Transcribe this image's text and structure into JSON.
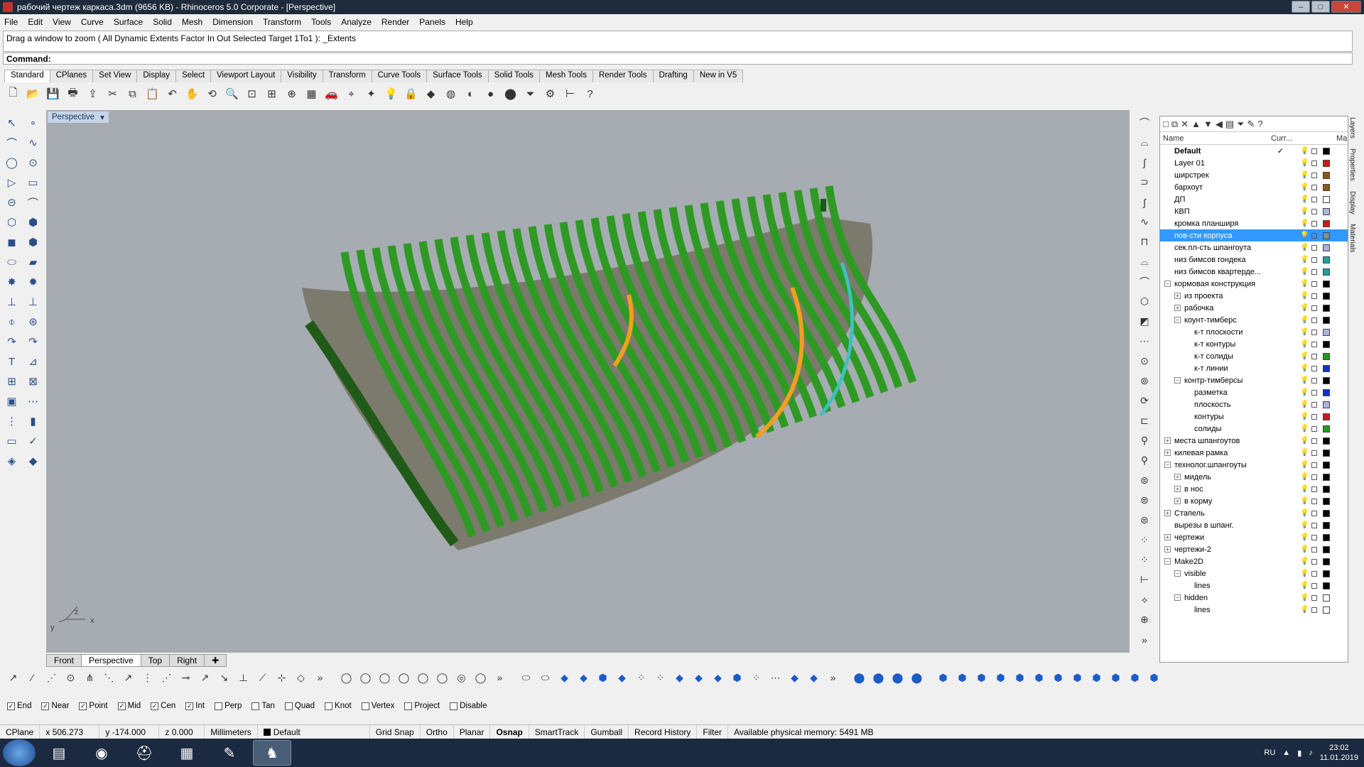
{
  "window": {
    "title": "рабочий чертеж каркаса.3dm (9656 KB) - Rhinoceros  5.0 Corporate - [Perspective]"
  },
  "menu": [
    "File",
    "Edit",
    "View",
    "Curve",
    "Surface",
    "Solid",
    "Mesh",
    "Dimension",
    "Transform",
    "Tools",
    "Analyze",
    "Render",
    "Panels",
    "Help"
  ],
  "command": {
    "history": "Drag a window to zoom ( All  Dynamic  Extents  Factor  In  Out  Selected  Target  1To1 ): _Extents",
    "prompt": "Command:"
  },
  "toolbar_tabs": [
    "Standard",
    "CPlanes",
    "Set View",
    "Display",
    "Select",
    "Viewport Layout",
    "Visibility",
    "Transform",
    "Curve Tools",
    "Surface Tools",
    "Solid Tools",
    "Mesh Tools",
    "Render Tools",
    "Drafting",
    "New in V5"
  ],
  "standard_icons": [
    "new-icon",
    "open-icon",
    "save-icon",
    "print-icon",
    "import-icon",
    "cut-icon",
    "copy-icon",
    "paste-icon",
    "undo-icon",
    "pan-icon",
    "rotate-view-icon",
    "zoom-icon",
    "zoom-window-icon",
    "zoom-extents-icon",
    "zoom-selected-icon",
    "viewport-layout-icon",
    "car-icon",
    "cplane-icon",
    "snap-icon",
    "light-icon",
    "lock-icon",
    "layer-icon",
    "color-wheel-icon",
    "shade-icon",
    "render-icon",
    "sphere-icon",
    "filter-icon",
    "settings-icon",
    "dimension-icon",
    "help-icon"
  ],
  "viewport": {
    "name": "Perspective",
    "axis_x": "x",
    "axis_y": "y",
    "axis_z": "z"
  },
  "viewport_tabs": [
    "Front",
    "Perspective",
    "Top",
    "Right"
  ],
  "layers_panel": {
    "columns": {
      "name": "Name",
      "current": "Curr...",
      "material": "Ma"
    },
    "side_tabs": [
      "Layers",
      "Properties",
      "Display",
      "Materials"
    ],
    "rows": [
      {
        "name": "Default",
        "indent": 0,
        "expander": "",
        "bold": true,
        "current": true,
        "color": "#000000",
        "selected": false
      },
      {
        "name": "Layer 01",
        "indent": 0,
        "expander": "",
        "color": "#d01818",
        "selected": false
      },
      {
        "name": "ширстрек",
        "indent": 0,
        "expander": "",
        "color": "#8a5a1a",
        "selected": false
      },
      {
        "name": "бархоут",
        "indent": 0,
        "expander": "",
        "color": "#8a5a1a",
        "selected": false
      },
      {
        "name": "ДП",
        "indent": 0,
        "expander": "",
        "color": "#ffffff",
        "selected": false
      },
      {
        "name": "КВП",
        "indent": 0,
        "expander": "",
        "color": "#a8b4e0",
        "selected": false
      },
      {
        "name": "кромка планширя",
        "indent": 0,
        "expander": "",
        "color": "#d01818",
        "selected": false
      },
      {
        "name": "пов-сти корпуса",
        "indent": 0,
        "expander": "",
        "color": "#8a8a8a",
        "selected": true
      },
      {
        "name": "сек.пл-сть шпангоута",
        "indent": 0,
        "expander": "",
        "color": "#a8b4e0",
        "selected": false
      },
      {
        "name": "низ бимсов гондека",
        "indent": 0,
        "expander": "",
        "color": "#20a0a0",
        "selected": false
      },
      {
        "name": "низ бимсов квартерде...",
        "indent": 0,
        "expander": "",
        "color": "#20a0a0",
        "selected": false
      },
      {
        "name": "кормовая конструкция",
        "indent": 0,
        "expander": "−",
        "color": "#000000",
        "selected": false
      },
      {
        "name": "из проекта",
        "indent": 1,
        "expander": "+",
        "color": "#000000",
        "selected": false
      },
      {
        "name": "рабочка",
        "indent": 1,
        "expander": "+",
        "color": "#000000",
        "selected": false
      },
      {
        "name": "коунт-тимберс",
        "indent": 1,
        "expander": "−",
        "color": "#000000",
        "selected": false
      },
      {
        "name": "к-т плоскости",
        "indent": 2,
        "expander": "",
        "color": "#a8b4e0",
        "selected": false
      },
      {
        "name": "к-т контуры",
        "indent": 2,
        "expander": "",
        "color": "#000000",
        "selected": false
      },
      {
        "name": "к-т солиды",
        "indent": 2,
        "expander": "",
        "color": "#18a018",
        "selected": false
      },
      {
        "name": "к-т линии",
        "indent": 2,
        "expander": "",
        "color": "#1030d0",
        "selected": false
      },
      {
        "name": "контр-тимберсы",
        "indent": 1,
        "expander": "−",
        "color": "#000000",
        "selected": false
      },
      {
        "name": "разметка",
        "indent": 2,
        "expander": "",
        "color": "#1030d0",
        "selected": false
      },
      {
        "name": "плоскость",
        "indent": 2,
        "expander": "",
        "color": "#a8b4e0",
        "selected": false
      },
      {
        "name": "контуры",
        "indent": 2,
        "expander": "",
        "color": "#d01818",
        "selected": false
      },
      {
        "name": "солиды",
        "indent": 2,
        "expander": "",
        "color": "#18a018",
        "selected": false
      },
      {
        "name": "места шпангоутов",
        "indent": 0,
        "expander": "+",
        "color": "#000000",
        "selected": false
      },
      {
        "name": "килевая рамка",
        "indent": 0,
        "expander": "+",
        "color": "#000000",
        "selected": false
      },
      {
        "name": "технолог.шпангоуты",
        "indent": 0,
        "expander": "−",
        "color": "#000000",
        "selected": false
      },
      {
        "name": "мидель",
        "indent": 1,
        "expander": "+",
        "color": "#000000",
        "selected": false
      },
      {
        "name": "в нос",
        "indent": 1,
        "expander": "+",
        "color": "#000000",
        "selected": false
      },
      {
        "name": "в корму",
        "indent": 1,
        "expander": "+",
        "color": "#000000",
        "selected": false
      },
      {
        "name": "Стапель",
        "indent": 0,
        "expander": "+",
        "color": "#000000",
        "selected": false
      },
      {
        "name": "вырезы в шпанг.",
        "indent": 0,
        "expander": "",
        "color": "#000000",
        "selected": false
      },
      {
        "name": "чертежи",
        "indent": 0,
        "expander": "+",
        "color": "#000000",
        "selected": false
      },
      {
        "name": "чертежи-2",
        "indent": 0,
        "expander": "+",
        "color": "#000000",
        "selected": false
      },
      {
        "name": "Make2D",
        "indent": 0,
        "expander": "−",
        "color": "#000000",
        "selected": false
      },
      {
        "name": "visible",
        "indent": 1,
        "expander": "−",
        "color": "#000000",
        "selected": false
      },
      {
        "name": "lines",
        "indent": 2,
        "expander": "",
        "color": "#000000",
        "selected": false
      },
      {
        "name": "hidden",
        "indent": 1,
        "expander": "−",
        "color": "#ffffff",
        "selected": false
      },
      {
        "name": "lines",
        "indent": 2,
        "expander": "",
        "color": "#ffffff",
        "selected": false
      }
    ]
  },
  "osnap": [
    {
      "label": "End",
      "checked": true
    },
    {
      "label": "Near",
      "checked": true
    },
    {
      "label": "Point",
      "checked": true
    },
    {
      "label": "Mid",
      "checked": true
    },
    {
      "label": "Cen",
      "checked": true
    },
    {
      "label": "Int",
      "checked": true
    },
    {
      "label": "Perp",
      "checked": false
    },
    {
      "label": "Tan",
      "checked": false
    },
    {
      "label": "Quad",
      "checked": false
    },
    {
      "label": "Knot",
      "checked": false
    },
    {
      "label": "Vertex",
      "checked": false
    },
    {
      "label": "Project",
      "checked": false
    },
    {
      "label": "Disable",
      "checked": false
    }
  ],
  "status": {
    "cplane": "CPlane",
    "x": "x 506.273",
    "y": "y -174.000",
    "z": "z 0.000",
    "units": "Millimeters",
    "layer": "Default",
    "grid_snap": "Grid Snap",
    "ortho": "Ortho",
    "planar": "Planar",
    "osnap": "Osnap",
    "smarttrack": "SmartTrack",
    "gumball": "Gumball",
    "record_history": "Record History",
    "filter": "Filter",
    "memory": "Available physical memory: 5491 MB"
  },
  "taskbar": {
    "lang": "RU",
    "time": "23:02",
    "date": "11.01.2019"
  }
}
